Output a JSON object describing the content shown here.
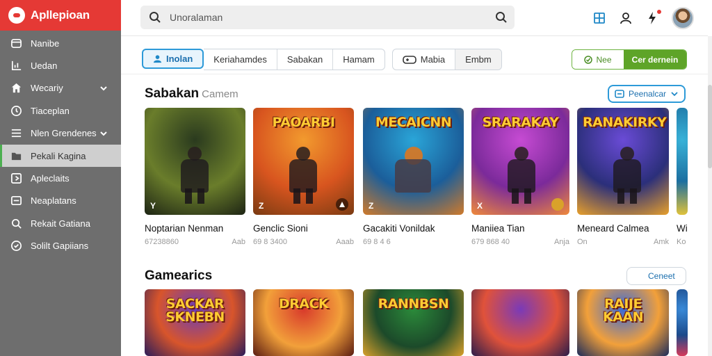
{
  "brand": {
    "name": "Apllepioan",
    "color": "#e53935"
  },
  "sidebar": {
    "items": [
      {
        "label": "Nanibe",
        "icon": "window-icon",
        "chevron": false,
        "active": false
      },
      {
        "label": "Uedan",
        "icon": "chart-icon",
        "chevron": false,
        "active": false
      },
      {
        "label": "Wecariy",
        "icon": "home-icon",
        "chevron": true,
        "active": false
      },
      {
        "label": "Tiaceplan",
        "icon": "clock-icon",
        "chevron": false,
        "active": false
      },
      {
        "label": "Nlen Grendenes",
        "icon": "menu-icon",
        "chevron": true,
        "active": false
      },
      {
        "label": "Pekali Kagina",
        "icon": "folder-icon",
        "chevron": false,
        "active": true
      },
      {
        "label": "Apleclaits",
        "icon": "export-icon",
        "chevron": false,
        "active": false
      },
      {
        "label": "Neaplatans",
        "icon": "tablet-icon",
        "chevron": false,
        "active": false
      },
      {
        "label": "Rekait Gatiana",
        "icon": "search-icon",
        "chevron": false,
        "active": false
      },
      {
        "label": "Solilt Gapiians",
        "icon": "settings-icon",
        "chevron": false,
        "active": false
      }
    ]
  },
  "search": {
    "placeholder": "Unoralaman"
  },
  "filters": {
    "group1": [
      {
        "label": "Inolan",
        "active": true
      },
      {
        "label": "Keriahamdes",
        "active": false
      },
      {
        "label": "Sabakan",
        "active": false
      },
      {
        "label": "Hamam",
        "active": false
      }
    ],
    "group2": [
      {
        "label": "Mabia",
        "icon": "gamepad-icon",
        "active": false
      },
      {
        "label": "Embm",
        "active": false
      }
    ]
  },
  "toggle": {
    "left_label": "Nee",
    "right_label": "Cer dernein"
  },
  "sections": [
    {
      "title": "Sabakan",
      "subtitle": "Camem",
      "button": "Peenalcar",
      "cards": [
        {
          "art": "",
          "title": "Noptarian Nenman",
          "meta_left": "67238860",
          "meta_right": "Aab",
          "badge": "Y",
          "colors": [
            "#2a3a1e",
            "#6a7d2b",
            "#1d2414"
          ]
        },
        {
          "art": "PAOARBI",
          "title": "Genclic Sioni",
          "meta_left": "69 8 3400",
          "meta_right": "Aaab",
          "badge": "Z",
          "colors": [
            "#f29a2e",
            "#d8551f",
            "#7a3b12"
          ]
        },
        {
          "art": "MECAICNN",
          "title": "Gacakiti Vonildak",
          "meta_left": "69 8 4 6",
          "meta_right": "",
          "badge": "Z",
          "colors": [
            "#2aa5d8",
            "#1b5e9a",
            "#d07a2a"
          ]
        },
        {
          "art": "SRARAKAY",
          "title": "Maniiea Tian",
          "meta_left": "679 868 40",
          "meta_right": "Anja",
          "badge": "X",
          "colors": [
            "#c64bd3",
            "#7b2a9a",
            "#f08a3a"
          ]
        },
        {
          "art": "RANAKIRKY",
          "title": "Meneard Calmea",
          "meta_left": "On",
          "meta_right": "Amk",
          "badge": "",
          "colors": [
            "#6a4bd6",
            "#2b2f7a",
            "#e8a02b"
          ]
        },
        {
          "art": "",
          "title": "Wi",
          "meta_left": "",
          "meta_right": "Ko",
          "badge": "",
          "colors": [
            "#38b2d8",
            "#1c6fa0",
            "#e0c23a"
          ]
        }
      ]
    },
    {
      "title": "Gamearics",
      "subtitle": "",
      "button": "Ceneet",
      "cards": [
        {
          "art": "SACKAR SKNEBN",
          "colors": [
            "#6a3db8",
            "#d8552b",
            "#2b1c5a"
          ]
        },
        {
          "art": "DRACK",
          "colors": [
            "#d83a2b",
            "#f2a03a",
            "#5a1c12"
          ]
        },
        {
          "art": "RANNBSN",
          "colors": [
            "#2b8a3a",
            "#1c4a2a",
            "#d8a02b"
          ]
        },
        {
          "art": "",
          "colors": [
            "#7a3ab8",
            "#e0523a",
            "#2b1c4a"
          ]
        },
        {
          "art": "RAIJE KAAN",
          "colors": [
            "#3a6ad8",
            "#f2a03a",
            "#1c2b5a"
          ]
        },
        {
          "art": "",
          "colors": [
            "#3a8ad8",
            "#1c4a8a",
            "#d83a5a"
          ]
        }
      ]
    }
  ]
}
